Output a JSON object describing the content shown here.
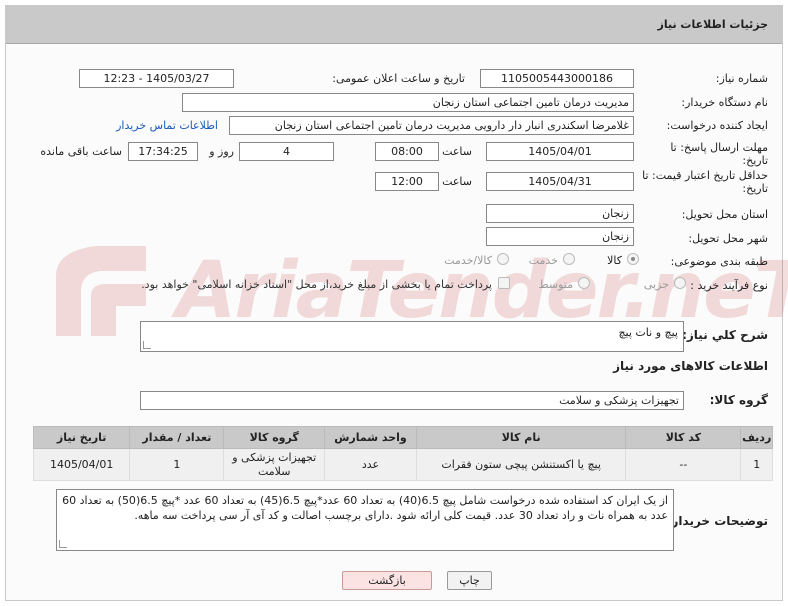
{
  "header": {
    "title": "جزئیات اطلاعات نیاز"
  },
  "watermark": {
    "text": "AriaTender.neT"
  },
  "fields": {
    "need_number_label": "شماره نیاز:",
    "need_number": "1105005443000186",
    "announce_label": "تاریخ و ساعت اعلان عمومی:",
    "announce_value": "1405/03/27 - 12:23",
    "buyer_label": "نام دستگاه خریدار:",
    "buyer_value": "مدیریت درمان تامین اجتماعی استان زنجان",
    "creator_label": "ایجاد کننده درخواست:",
    "creator_value": "غلامرضا  اسکندری انبار دار دارویی مدیریت درمان تامین اجتماعی استان زنجان",
    "contact_link": "اطلاعات تماس خریدار",
    "reply_deadline_label": "مهلت ارسال پاسخ: تا تاریخ:",
    "reply_date": "1405/04/01",
    "time_label": "ساعت",
    "reply_time": "08:00",
    "days_value": "4",
    "days_label": "روز و",
    "remaining_time": "17:34:25",
    "remaining_label": "ساعت باقی مانده",
    "price_validity_label": "حداقل تاریخ اعتبار قیمت: تا تاریخ:",
    "price_date": "1405/04/31",
    "price_time": "12:00",
    "province_label": "استان محل تحویل:",
    "province_value": "زنجان",
    "city_label": "شهر محل تحویل:",
    "city_value": "زنجان",
    "category_label": "طبقه بندی موضوعی:",
    "category_options": [
      "کالا",
      "خدمت",
      "کالا/خدمت"
    ],
    "process_label": "نوع فرآیند خرید :",
    "process_options": [
      "جزیی",
      "متوسط"
    ],
    "payment_note": "پرداخت تمام یا بخشی از مبلغ خرید،از محل \"اسناد خزانه اسلامی\" خواهد بود.",
    "description_label": "شرح كلي نياز:",
    "description_value": "پیچ و نات پیچ",
    "goods_info_title": "اطلاعات کالاهای مورد نیاز",
    "goods_group_label": "گروه کالا:",
    "goods_group_value": "تجهیزات پزشکی و سلامت"
  },
  "table": {
    "headers": [
      "ردیف",
      "کد کالا",
      "نام کالا",
      "واحد شمارش",
      "گروه کالا",
      "تعداد / مقدار",
      "تاریخ نیاز"
    ],
    "rows": [
      [
        "1",
        "--",
        "پیچ یا اکستنشن پیچی ستون فقرات",
        "عدد",
        "تجهیزات پزشکی و سلامت",
        "1",
        "1405/04/01"
      ]
    ]
  },
  "buyer_notes": {
    "label": "توضیحات خریدار:",
    "text": "از یک ایران کد استفاده شده درخواست شامل پیچ 6.5(40) به تعداد 60 عدد*پیچ 6.5(45) به تعداد 60 عدد *پیچ 6.5(50) به تعداد 60 عدد به همراه نات و راد تعداد 30 عدد. قیمت کلی ارائه شود .دارای برچسب اصالت و کد آی آر سی پرداخت سه ماهه."
  },
  "buttons": {
    "print": "چاپ",
    "back": "بازگشت"
  }
}
